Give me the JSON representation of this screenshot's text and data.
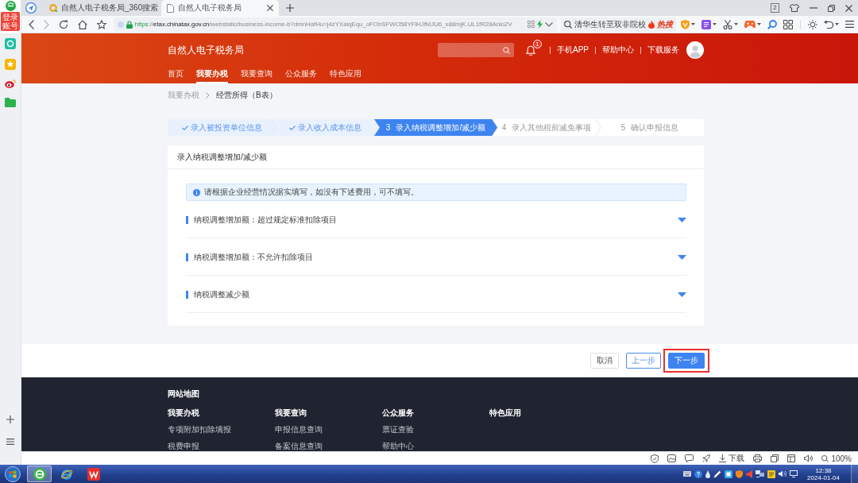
{
  "browser": {
    "sidebar": {
      "badge": "登录账号"
    },
    "tabs": [
      {
        "title": "自然人电子税务局_360搜索",
        "kind": "search",
        "selected": false
      },
      {
        "title": "自然人电子税务局",
        "kind": "page",
        "selected": true
      }
    ],
    "tab_count": "2",
    "url": {
      "scheme": "https",
      "separator": "://",
      "host": "etax.chinatax.gov.cn",
      "path": "/webstatic/business-income-b?dmnHafHu=j4zYXalqEqu_oFObSFWO58YFlHJfMJU6_x88mjK.UL1fR28Anlo2V"
    },
    "search": {
      "value": "清华生转至双非院校",
      "hot_label": "热搜"
    },
    "status_bar": {
      "download_label": "下载",
      "zoom": "100%"
    }
  },
  "site": {
    "title": "自然人电子税务局",
    "notification_count": "1",
    "links": [
      "手机APP",
      "帮助中心",
      "下载服务"
    ],
    "nav": [
      {
        "label": "首页",
        "selected": false
      },
      {
        "label": "我要办税",
        "selected": true
      },
      {
        "label": "我要查询",
        "selected": false
      },
      {
        "label": "公众服务",
        "selected": false
      },
      {
        "label": "特色应用",
        "selected": false
      }
    ]
  },
  "breadcrumb": [
    "我要办税",
    "经营所得（B表）"
  ],
  "steps": [
    {
      "label": "录入被投资单位信息",
      "done": true,
      "selected": false
    },
    {
      "label": "录入收入成本信息",
      "done": true,
      "selected": false
    },
    {
      "number": "3",
      "label": "录入纳税调整增加/减少额",
      "done": false,
      "selected": true
    },
    {
      "number": "4",
      "label": "录入其他税前减免事项",
      "done": false,
      "selected": false
    },
    {
      "number": "5",
      "label": "确认申报信息",
      "done": false,
      "selected": false
    }
  ],
  "form": {
    "title": "录入纳税调整增加/减少额",
    "notice": "请根据企业经营情况据实填写，如没有下述费用，可不填写。",
    "sections": [
      {
        "title": "纳税调整增加额：超过规定标准扣除项目",
        "expanded": false
      },
      {
        "title": "纳税调整增加额：不允许扣除项目",
        "expanded": false
      },
      {
        "title": "纳税调整减少额",
        "expanded": false
      }
    ]
  },
  "actions": [
    {
      "label": "取消",
      "kind": "cancel",
      "highlighted": false
    },
    {
      "label": "上一步",
      "kind": "back",
      "highlighted": false
    },
    {
      "label": "下一步",
      "kind": "next",
      "highlighted": true
    }
  ],
  "footer": {
    "title": "网站地图",
    "columns": [
      {
        "heading": "我要办税",
        "links": [
          "专项附加扣除填报",
          "税费申报"
        ]
      },
      {
        "heading": "我要查询",
        "links": [
          "申报信息查询",
          "备案信息查询"
        ]
      },
      {
        "heading": "公众服务",
        "links": [
          "票证查验",
          "帮助中心"
        ]
      },
      {
        "heading": "特色应用"
      }
    ]
  },
  "taskbar": {
    "apps": [
      {
        "kind": "browser",
        "selected": true
      },
      {
        "kind": "ie",
        "selected": false
      },
      {
        "kind": "office",
        "selected": false
      }
    ],
    "time": "12:38",
    "date": "2024-01-04"
  }
}
